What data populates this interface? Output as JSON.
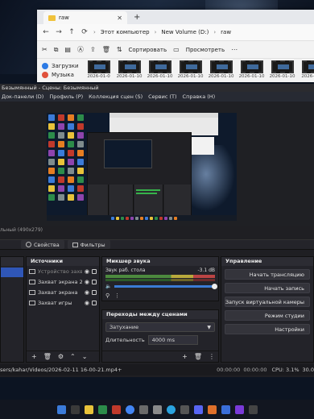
{
  "explorer": {
    "tab_title": "raw",
    "path": [
      "Этот компьютер",
      "New Volume (D:)",
      "raw"
    ],
    "toolbar": {
      "sort_label": "Сортировать",
      "view_label": "Просмотреть"
    },
    "nav": {
      "downloads_label": "Загрузки",
      "music_label": "Музыка"
    },
    "files": [
      "2026-01-0",
      "2026-01-10",
      "2026-01-10",
      "2026-01-10",
      "2026-01-10",
      "2026-01-10",
      "2026-01-10",
      "2026-01-1"
    ]
  },
  "obs": {
    "title": "Безымянный - Сцены: Безымянный",
    "menu": [
      "Док-панели (D)",
      "Профиль (P)",
      "Коллекция сцен (S)",
      "Сервис (T)",
      "Справка (H)"
    ],
    "preview_label": "льный (490x279)",
    "sources_toolbar": {
      "properties_label": "Свойства",
      "filters_label": "Фильтры"
    },
    "sources": {
      "header": "Источники",
      "items": [
        {
          "label": "Устройство захв",
          "dim": true
        },
        {
          "label": "Захват экрана 2",
          "dim": false
        },
        {
          "label": "Захват экрана",
          "dim": false
        },
        {
          "label": "Захват игры",
          "dim": false
        }
      ]
    },
    "mixer": {
      "header": "Микшер звука",
      "channel_name": "Звук раб. стола",
      "db_value": "-3.1 dB"
    },
    "transitions": {
      "header": "Переходы между сценами",
      "selected": "Затухание",
      "duration_label": "Длительность",
      "duration_value": "4000 ms"
    },
    "controls": {
      "header": "Управление",
      "buttons": [
        "Начать трансляцию",
        "Начать запись",
        "Запуск виртуальной камеры",
        "Режим студии",
        "Настройки"
      ]
    },
    "status": {
      "path": "sers/kahar/Videos/2026-02-11 16-00-21.mp4+",
      "stream_time": "00:00:00",
      "rec_time": "00:00:00",
      "cpu": "CPU: 3.1%",
      "fps": "30.0"
    }
  },
  "colors": {
    "accent_blue": "#2f56b7",
    "meter_green": "#4c8a3e",
    "obs_bg": "#1f1f23"
  }
}
